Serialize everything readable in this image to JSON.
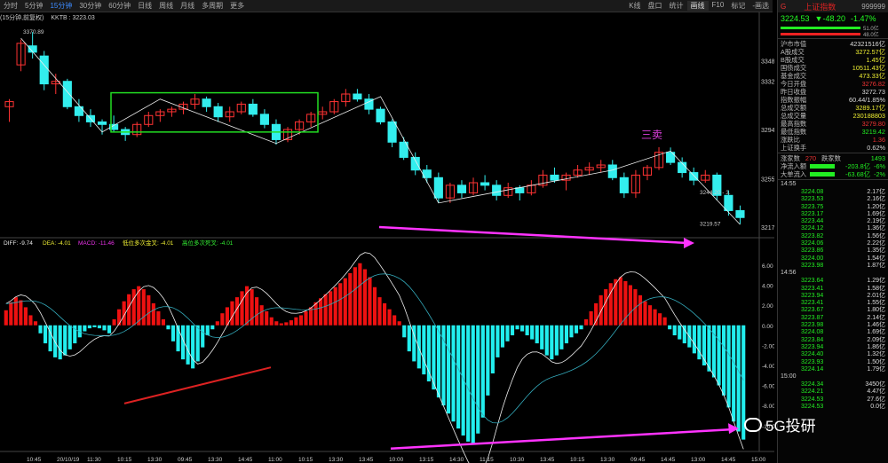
{
  "toolbar": {
    "tabs": [
      "分时",
      "5分钟",
      "15分钟",
      "30分钟",
      "60分钟",
      "日线",
      "周线",
      "月线",
      "多周期",
      "更多"
    ],
    "active_tab": 2,
    "right_tabs": [
      "K线",
      "盘口",
      "统计",
      "画线",
      "F10",
      "标记",
      "-画选"
    ],
    "active_right_tab": 3
  },
  "infobar": {
    "period": "(15分钟,前复权)",
    "kktb_label": "KKTB : 3223.03"
  },
  "price_axis": {
    "labels": [
      "3348.4",
      "3332",
      "3294",
      "3255",
      "3217"
    ],
    "annotations": [
      "3370.89",
      "3244.20 - 3.",
      "3219.57"
    ]
  },
  "annotation_text": "三卖",
  "macd_legend": {
    "diff": "DIFF: -9.74",
    "dea": "DEA: -4.01",
    "macd": "MACD: -11.46",
    "gold": "低位多次金叉: -4.01",
    "dead": "高位多次死叉: -4.01"
  },
  "macd_axis": [
    "6.00",
    "4.00",
    "2.00",
    "0.00",
    "-2.00",
    "-4.00",
    "-6.00",
    "-8.00",
    "-10.00"
  ],
  "time_axis": [
    "10:45",
    "20/10/19",
    "11:30",
    "10:15",
    "13:30",
    "09:45",
    "13:30",
    "14:45",
    "11:00",
    "10:15",
    "13:30",
    "13:45",
    "10:00",
    "13:15",
    "14:30",
    "11:15",
    "10:30",
    "13:45",
    "10:15",
    "13:30",
    "09:45",
    "14:45",
    "13:00",
    "14:45",
    "15:00"
  ],
  "panel": {
    "title": "上证指数",
    "code": "999999",
    "price": "3224.53",
    "change": "▼-48.20",
    "pct": "-1.47%",
    "bar1_pct": "51.0亿",
    "bar2_pct": "48.0亿",
    "stats": [
      {
        "k": "沪市市值",
        "v": "42321516亿",
        "c": "#ddd"
      },
      {
        "k": "A股成交",
        "v": "3272.57亿",
        "c": "#ee3"
      },
      {
        "k": "B股成交",
        "v": "1.45亿",
        "c": "#ee3"
      },
      {
        "k": "国债成交",
        "v": "10511.43亿",
        "c": "#ee3"
      },
      {
        "k": "基金成交",
        "v": "473.33亿",
        "c": "#ee3"
      },
      {
        "k": "今日开盘",
        "v": "3276.82",
        "c": "#e33"
      },
      {
        "k": "昨日收盘",
        "v": "3272.73",
        "c": "#ddd"
      },
      {
        "k": "指数振幅",
        "v": "60.44/1.85%",
        "c": "#ddd"
      },
      {
        "k": "总成交额",
        "v": "3289.17亿",
        "c": "#ee3"
      },
      {
        "k": "总成交量",
        "v": "230188803",
        "c": "#ee3"
      },
      {
        "k": "最高指数",
        "v": "3279.80",
        "c": "#e33"
      },
      {
        "k": "最低指数",
        "v": "3219.42",
        "c": "#2e2"
      },
      {
        "k": "涨跌比",
        "v": "1.36",
        "c": "#e33"
      },
      {
        "k": "上证换手",
        "v": "0.62%",
        "c": "#ddd"
      }
    ],
    "updown": {
      "up_label": "涨家数",
      "up": "270",
      "down_label": "跌家数",
      "down": "1493"
    },
    "flows": [
      {
        "k": "净流入额",
        "v": "-203.8亿",
        "p": "-6%"
      },
      {
        "k": "大单流入",
        "v": "-63.68亿",
        "p": "-2%"
      }
    ],
    "time1": "14:55",
    "ticks1": [
      {
        "p": "3224.08",
        "a": "2.17亿"
      },
      {
        "p": "3223.53",
        "a": "2.16亿"
      },
      {
        "p": "3223.75",
        "a": "1.20亿"
      },
      {
        "p": "3223.17",
        "a": "1.69亿"
      },
      {
        "p": "3223.44",
        "a": "2.19亿"
      },
      {
        "p": "3224.12",
        "a": "1.36亿"
      },
      {
        "p": "3223.82",
        "a": "1.56亿"
      },
      {
        "p": "3224.06",
        "a": "2.22亿"
      },
      {
        "p": "3223.86",
        "a": "1.35亿"
      },
      {
        "p": "3224.00",
        "a": "1.54亿"
      },
      {
        "p": "3223.98",
        "a": "1.87亿"
      }
    ],
    "time2": "14:56",
    "ticks2": [
      {
        "p": "3223.64",
        "a": "1.29亿"
      },
      {
        "p": "3223.41",
        "a": "1.58亿"
      },
      {
        "p": "3223.94",
        "a": "2.01亿"
      },
      {
        "p": "3223.41",
        "a": "1.55亿"
      },
      {
        "p": "3223.67",
        "a": "1.80亿"
      },
      {
        "p": "3223.87",
        "a": "2.14亿"
      },
      {
        "p": "3223.98",
        "a": "1.46亿"
      },
      {
        "p": "3224.08",
        "a": "1.69亿"
      },
      {
        "p": "3223.84",
        "a": "2.09亿"
      },
      {
        "p": "3223.94",
        "a": "1.86亿"
      },
      {
        "p": "3224.40",
        "a": "1.32亿"
      },
      {
        "p": "3223.93",
        "a": "1.50亿"
      },
      {
        "p": "3224.14",
        "a": "1.79亿"
      }
    ],
    "time3": "15:00",
    "ticks3": [
      {
        "p": "3224.34",
        "a": "3450亿"
      },
      {
        "p": "3224.21",
        "a": "4.47亿"
      },
      {
        "p": "3224.53",
        "a": "27.6亿"
      },
      {
        "p": "3224.53",
        "a": "0.0亿"
      }
    ]
  },
  "watermark": "5G投研",
  "colors": {
    "up": "#ff3333",
    "down": "#33eeee",
    "macd_up": "#e11",
    "macd_down": "#2ee",
    "box": "#22dd22",
    "arrow": "#ff33ff",
    "divergence": "#dd2222",
    "annotation": "#e040e0"
  },
  "chart_data": {
    "type": "candlestick",
    "title": "上证指数 15分钟",
    "candles": [
      [
        3312,
        3318,
        3300,
        3316
      ],
      [
        3345,
        3365,
        3340,
        3362
      ],
      [
        3360,
        3370.89,
        3350,
        3355
      ],
      [
        3352,
        3356,
        3325,
        3330
      ],
      [
        3330,
        3338,
        3322,
        3332
      ],
      [
        3332,
        3334,
        3310,
        3312
      ],
      [
        3312,
        3318,
        3300,
        3305
      ],
      [
        3305,
        3310,
        3296,
        3300
      ],
      [
        3300,
        3302,
        3290,
        3298
      ],
      [
        3298,
        3305,
        3292,
        3294
      ],
      [
        3294,
        3296,
        3285,
        3290
      ],
      [
        3290,
        3300,
        3288,
        3298
      ],
      [
        3298,
        3308,
        3296,
        3305
      ],
      [
        3305,
        3310,
        3300,
        3308
      ],
      [
        3308,
        3312,
        3304,
        3310
      ],
      [
        3310,
        3316,
        3306,
        3314
      ],
      [
        3314,
        3322,
        3310,
        3318
      ],
      [
        3318,
        3320,
        3308,
        3312
      ],
      [
        3312,
        3315,
        3300,
        3304
      ],
      [
        3304,
        3312,
        3300,
        3308
      ],
      [
        3308,
        3316,
        3306,
        3314
      ],
      [
        3314,
        3318,
        3304,
        3306
      ],
      [
        3306,
        3310,
        3295,
        3298
      ],
      [
        3298,
        3302,
        3282,
        3286
      ],
      [
        3286,
        3296,
        3284,
        3294
      ],
      [
        3294,
        3302,
        3290,
        3300
      ],
      [
        3300,
        3308,
        3296,
        3306
      ],
      [
        3306,
        3312,
        3302,
        3308
      ],
      [
        3308,
        3318,
        3306,
        3316
      ],
      [
        3316,
        3326,
        3312,
        3322
      ],
      [
        3322,
        3326,
        3316,
        3318
      ],
      [
        3318,
        3322,
        3306,
        3310
      ],
      [
        3310,
        3312,
        3298,
        3300
      ],
      [
        3300,
        3302,
        3280,
        3284
      ],
      [
        3284,
        3288,
        3270,
        3272
      ],
      [
        3272,
        3276,
        3258,
        3262
      ],
      [
        3262,
        3266,
        3252,
        3256
      ],
      [
        3256,
        3260,
        3236,
        3240
      ],
      [
        3240,
        3252,
        3236,
        3250
      ],
      [
        3250,
        3254,
        3240,
        3244
      ],
      [
        3244,
        3256,
        3242,
        3252
      ],
      [
        3252,
        3258,
        3246,
        3250
      ],
      [
        3250,
        3254,
        3238,
        3242
      ],
      [
        3242,
        3252,
        3240,
        3248
      ],
      [
        3248,
        3250,
        3238,
        3244
      ],
      [
        3244,
        3254,
        3242,
        3250
      ],
      [
        3250,
        3262,
        3248,
        3258
      ],
      [
        3258,
        3264,
        3252,
        3254
      ],
      [
        3254,
        3260,
        3246,
        3258
      ],
      [
        3258,
        3266,
        3256,
        3262
      ],
      [
        3262,
        3268,
        3258,
        3264
      ],
      [
        3264,
        3270,
        3260,
        3266
      ],
      [
        3266,
        3270,
        3254,
        3256
      ],
      [
        3256,
        3260,
        3240,
        3244
      ],
      [
        3244,
        3262,
        3240,
        3258
      ],
      [
        3258,
        3266,
        3254,
        3264
      ],
      [
        3264,
        3280,
        3262,
        3276
      ],
      [
        3276,
        3279.8,
        3266,
        3268
      ],
      [
        3268,
        3272,
        3256,
        3260
      ],
      [
        3260,
        3264,
        3250,
        3254
      ],
      [
        3254,
        3262,
        3252,
        3258
      ],
      [
        3258,
        3260,
        3238,
        3242
      ],
      [
        3242,
        3246,
        3226,
        3230
      ],
      [
        3230,
        3234,
        3219.42,
        3224.53
      ]
    ],
    "price_range": [
      3210,
      3378
    ],
    "macd": [
      1.5,
      2.3,
      2.8,
      2.5,
      1.8,
      1.0,
      0.4,
      -0.8,
      -1.8,
      -2.6,
      -3.2,
      -3.4,
      -3.0,
      -2.4,
      -1.8,
      -1.2,
      -0.6,
      -0.3,
      -0.2,
      -0.3,
      -0.5,
      -0.8,
      0.6,
      1.6,
      2.4,
      3.1,
      3.6,
      3.9,
      3.6,
      3.0,
      2.2,
      1.4,
      0.6,
      -0.4,
      -1.6,
      -2.6,
      -3.4,
      -3.9,
      -4.3,
      -3.6,
      -2.2,
      -1.0,
      -0.4,
      0.4,
      1.2,
      1.8,
      2.4,
      2.8,
      3.4,
      3.9,
      3.6,
      2.8,
      2.0,
      1.4,
      0.8,
      0.4,
      0.2,
      0.3,
      0.5,
      0.8,
      1.0,
      1.4,
      1.8,
      2.3,
      2.7,
      3.1,
      3.4,
      3.8,
      4.2,
      4.7,
      5.2,
      5.8,
      6.2,
      5.6,
      4.8,
      3.8,
      2.8,
      2.2,
      1.6,
      1.0,
      0.4,
      -1.2,
      -2.6,
      -3.6,
      -4.3,
      -4.9,
      -5.6,
      -6.4,
      -7.2,
      -8.0,
      -8.8,
      -9.6,
      -10.3,
      -11.0,
      -11.6,
      -11.8,
      -10.8,
      -9.2,
      -7.0,
      -4.8,
      -3.2,
      -2.2,
      -1.6,
      -1.0,
      -0.4,
      -0.6,
      -1.0,
      -1.4,
      -1.8,
      -2.4,
      -3.0,
      -3.4,
      -3.0,
      -2.4,
      -1.8,
      -1.2,
      -0.8,
      -0.4,
      0.6,
      1.4,
      2.2,
      3.0,
      3.6,
      4.2,
      4.6,
      4.8,
      4.4,
      4.0,
      3.6,
      3.0,
      2.4,
      2.0,
      1.6,
      1.2,
      0.8,
      -0.4,
      -1.0,
      -1.4,
      -1.8,
      -2.2,
      -2.8,
      -3.4,
      -4.0,
      -4.6,
      -5.2,
      -6.0,
      -7.0,
      -8.2,
      -9.6,
      -10.6,
      -11.4
    ],
    "macd_range": [
      -12.5,
      7.5
    ]
  }
}
